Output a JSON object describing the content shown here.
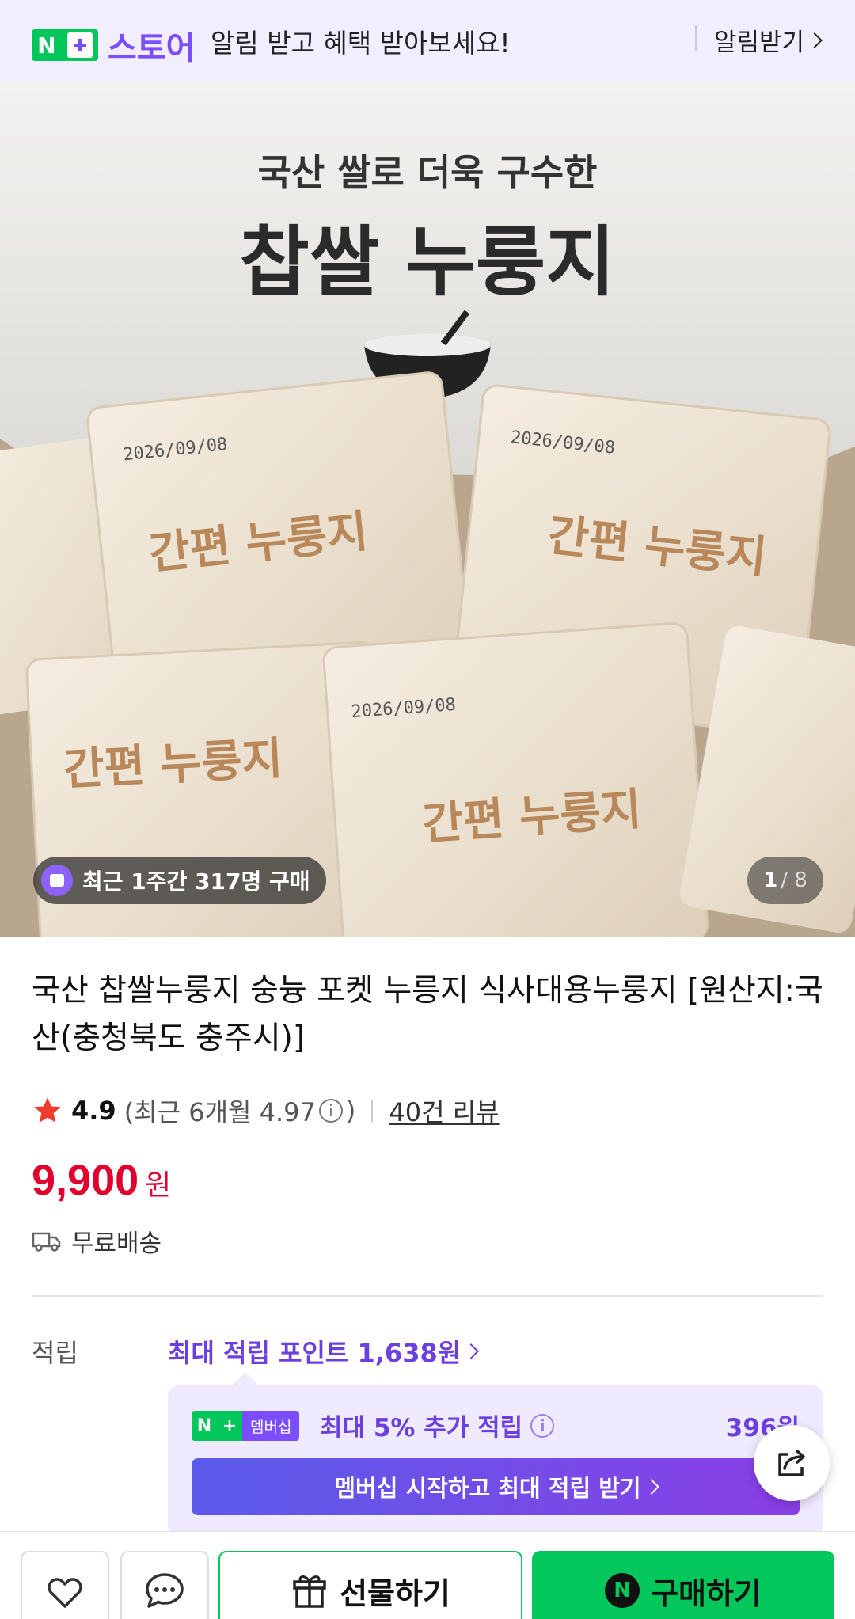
{
  "banner": {
    "logo_n": "N",
    "logo_text": "스토어",
    "message": "알림 받고 혜택 받아보세요!",
    "action": "알림받기"
  },
  "hero": {
    "box_sub": "국산 쌀로 더욱 구수한",
    "box_title": "찹쌀 누룽지",
    "pack_label": "간편 누룽지",
    "pack_date": "2026/09/08",
    "buy_badge": "최근 1주간 317명 구매",
    "page_current": "1",
    "page_total": "/ 8"
  },
  "product": {
    "title": "국산 찹쌀누룽지 숭늉 포켓 누릉지 식사대용누룽지 [원산지:국산(충청북도 충주시)]",
    "rating": "4.9",
    "rating_recent": "(최근 6개월 4.97",
    "rating_recent_close": ")",
    "reviews": "40건 리뷰",
    "price": "9,900",
    "price_unit": "원",
    "shipping": "무료배송"
  },
  "points": {
    "label": "적립",
    "max": "최대 적립 포인트 1,638원",
    "member_badge": "멤버십",
    "member_extra": "최대 5% 추가 적립",
    "member_amount": "396원",
    "member_button": "멤버십 시작하고 최대 적립 받기"
  },
  "bottom": {
    "gift": "선물하기",
    "buy": "구매하기"
  },
  "colors": {
    "naver_green": "#03c75a",
    "purple": "#7b4dff",
    "price_red": "#e1002d"
  },
  "icons": [
    "store-logo",
    "chevron-right-icon",
    "shopping-bag-icon",
    "star-icon",
    "info-icon",
    "truck-icon",
    "share-icon",
    "heart-link-icon",
    "chat-icon",
    "gift-icon",
    "naver-n-icon"
  ]
}
